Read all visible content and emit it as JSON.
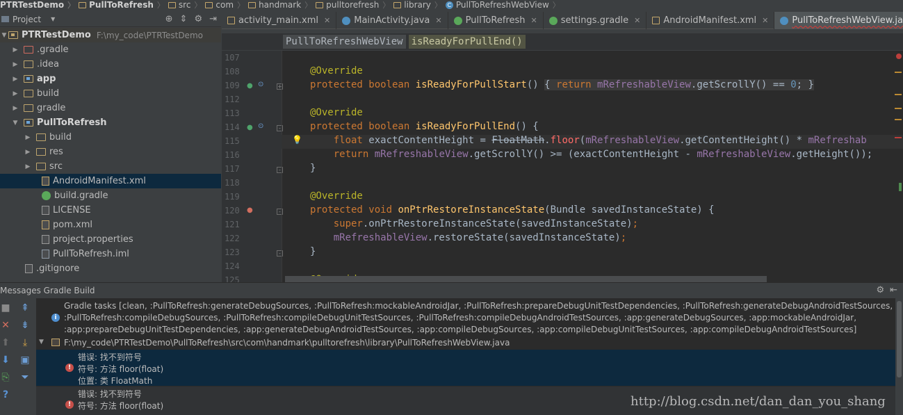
{
  "breadcrumb": [
    "PTRTestDemo",
    "PullToRefresh",
    "src",
    "com",
    "handmark",
    "pulltorefresh",
    "library",
    "PullToRefreshWebView"
  ],
  "project_panel": {
    "title": "Project",
    "root": {
      "name": "PTRTestDemo",
      "path": "F:\\my_code\\PTRTestDemo"
    },
    "items": [
      {
        "name": ".gradle"
      },
      {
        "name": ".idea"
      },
      {
        "name": "app"
      },
      {
        "name": "build"
      },
      {
        "name": "gradle"
      },
      {
        "name": "PullToRefresh"
      },
      {
        "name": "build"
      },
      {
        "name": "res"
      },
      {
        "name": "src"
      },
      {
        "name": "AndroidManifest.xml"
      },
      {
        "name": "build.gradle"
      },
      {
        "name": "LICENSE"
      },
      {
        "name": "pom.xml"
      },
      {
        "name": "project.properties"
      },
      {
        "name": "PullToRefresh.iml"
      },
      {
        "name": ".gitignore"
      }
    ]
  },
  "tabs": [
    {
      "label": "activity_main.xml"
    },
    {
      "label": "MainActivity.java"
    },
    {
      "label": "PullToRefresh"
    },
    {
      "label": "settings.gradle"
    },
    {
      "label": "AndroidManifest.xml"
    },
    {
      "label": "PullToRefreshWebView.java"
    }
  ],
  "structure": {
    "class": "PullToRefreshWebView",
    "method": "isReadyForPullEnd()"
  },
  "editor": {
    "lines": [
      "107",
      "108",
      "109",
      "112",
      "113",
      "114",
      "115",
      "116",
      "117",
      "118",
      "119",
      "120",
      "121",
      "122",
      "123",
      "124",
      "125"
    ]
  },
  "messages": {
    "title": "Messages Gradle Build",
    "gradle_tasks": [
      "Gradle tasks [clean, :PullToRefresh:generateDebugSources, :PullToRefresh:mockableAndroidJar, :PullToRefresh:prepareDebugUnitTestDependencies, :PullToRefresh:generateDebugAndroidTestSources,",
      ":PullToRefresh:compileDebugSources, :PullToRefresh:compileDebugUnitTestSources, :PullToRefresh:compileDebugAndroidTestSources, :app:generateDebugSources, :app:mockableAndroidJar,",
      ":app:prepareDebugUnitTestDependencies, :app:generateDebugAndroidTestSources, :app:compileDebugSources, :app:compileDebugUnitTestSources, :app:compileDebugAndroidTestSources]"
    ],
    "file": "F:\\my_code\\PTRTestDemo\\PullToRefresh\\src\\com\\handmark\\pulltorefresh\\library\\PullToRefreshWebView.java",
    "errors": [
      {
        "line1": "错误: 找不到符号",
        "line2": "符号:   方法 floor(float)",
        "line3": "位置: 类 FloatMath"
      },
      {
        "line1": "错误: 找不到符号",
        "line2": "符号:   方法 floor(float)"
      }
    ]
  },
  "watermark": "http://blog.csdn.net/dan_dan_you_shang"
}
